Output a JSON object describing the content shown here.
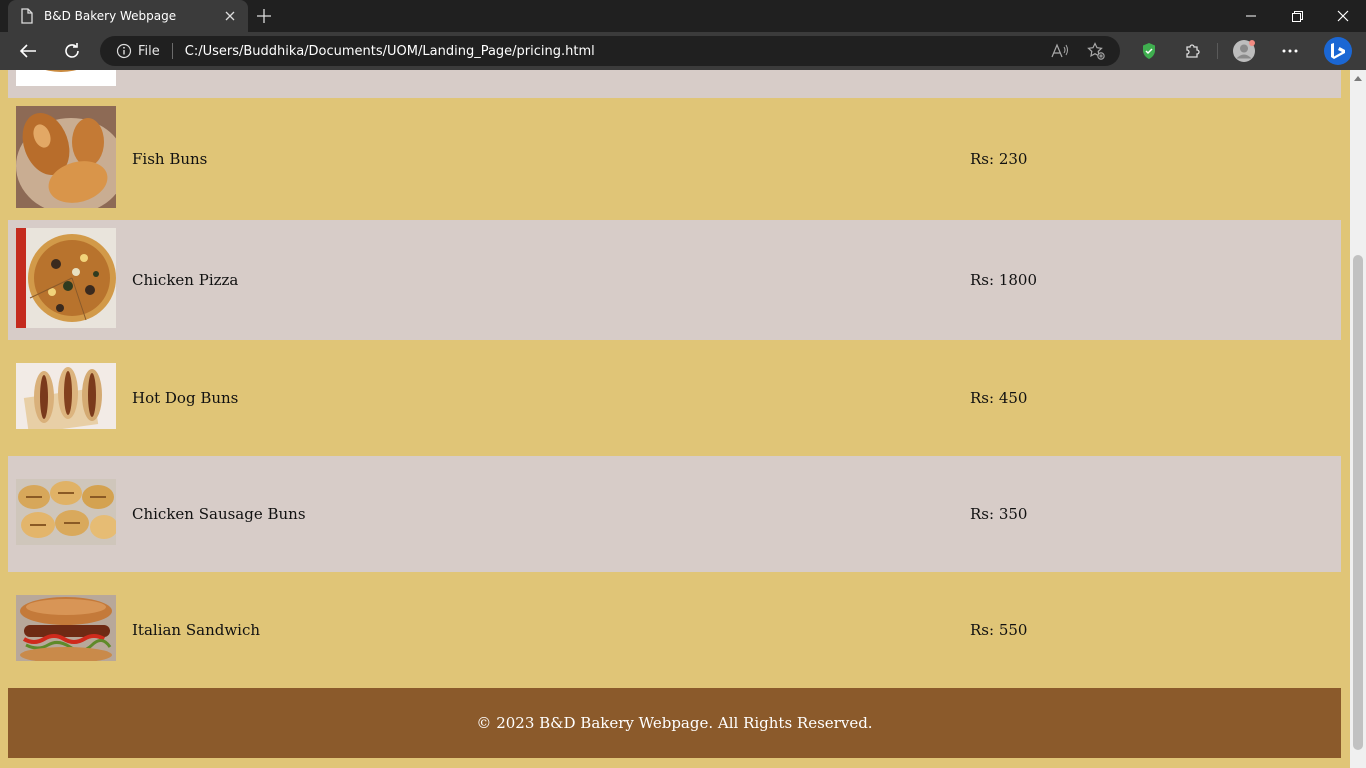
{
  "browser": {
    "tab_title": "B&D Bakery Webpage",
    "scheme_label": "File",
    "url": "C:/Users/Buddhika/Documents/UOM/Landing_Page/pricing.html"
  },
  "menu_items": [
    {
      "name": "Fish Buns",
      "price": "Rs: 230"
    },
    {
      "name": "Chicken Pizza",
      "price": "Rs: 1800"
    },
    {
      "name": "Hot Dog Buns",
      "price": "Rs: 450"
    },
    {
      "name": "Chicken Sausage Buns",
      "price": "Rs: 350"
    },
    {
      "name": "Italian Sandwich",
      "price": "Rs: 550"
    }
  ],
  "footer": {
    "text": "© 2023 B&D Bakery Webpage. All Rights Reserved."
  },
  "colors": {
    "page_background": "#e0c577",
    "alt_row": "#d7ccc8",
    "footer_background": "#8b5a2b",
    "browser_frame": "#202020",
    "browser_toolbar": "#3b3b3b"
  }
}
